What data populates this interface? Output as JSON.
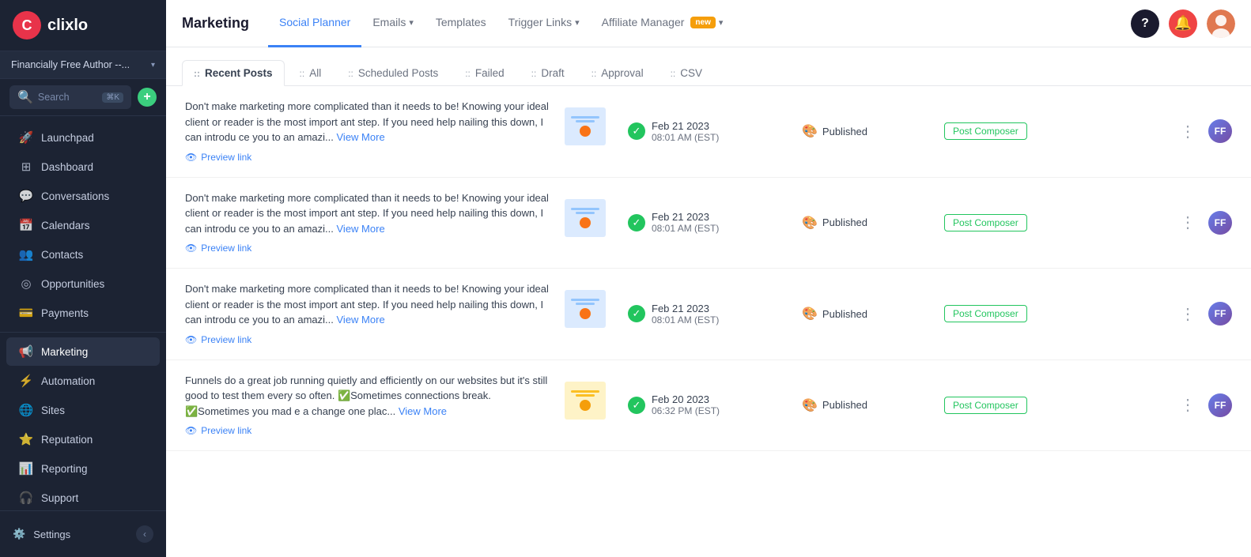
{
  "app": {
    "logo_letter": "C",
    "logo_name": "clixlo"
  },
  "account": {
    "name": "Financially Free Author --...",
    "dropdown_label": "Financially Free Author --..."
  },
  "search": {
    "placeholder": "Search",
    "shortcut": "⌘K"
  },
  "sidebar": {
    "items": [
      {
        "id": "launchpad",
        "label": "Launchpad",
        "icon": "🚀"
      },
      {
        "id": "dashboard",
        "label": "Dashboard",
        "icon": "⊞"
      },
      {
        "id": "conversations",
        "label": "Conversations",
        "icon": "💬"
      },
      {
        "id": "calendars",
        "label": "Calendars",
        "icon": "📅"
      },
      {
        "id": "contacts",
        "label": "Contacts",
        "icon": "👥"
      },
      {
        "id": "opportunities",
        "label": "Opportunities",
        "icon": "◎"
      },
      {
        "id": "payments",
        "label": "Payments",
        "icon": "💳"
      },
      {
        "id": "marketing",
        "label": "Marketing",
        "icon": "📢",
        "active": true
      },
      {
        "id": "automation",
        "label": "Automation",
        "icon": "⚡"
      },
      {
        "id": "sites",
        "label": "Sites",
        "icon": "🌐"
      },
      {
        "id": "reputation",
        "label": "Reputation",
        "icon": "⭐"
      },
      {
        "id": "reporting",
        "label": "Reporting",
        "icon": "📊"
      },
      {
        "id": "support",
        "label": "Support",
        "icon": "🎧"
      }
    ],
    "footer": {
      "settings_label": "Settings",
      "settings_icon": "⚙️"
    }
  },
  "topbar": {
    "title": "Marketing",
    "nav_items": [
      {
        "id": "social-planner",
        "label": "Social Planner",
        "active": true,
        "has_dropdown": false
      },
      {
        "id": "emails",
        "label": "Emails",
        "active": false,
        "has_dropdown": true
      },
      {
        "id": "templates",
        "label": "Templates",
        "active": false,
        "has_dropdown": false
      },
      {
        "id": "trigger-links",
        "label": "Trigger Links",
        "active": false,
        "has_dropdown": true
      },
      {
        "id": "affiliate-manager",
        "label": "Affiliate Manager",
        "active": false,
        "has_dropdown": true,
        "badge": "new"
      }
    ]
  },
  "tabs": [
    {
      "id": "recent-posts",
      "label": "Recent Posts",
      "active": true
    },
    {
      "id": "all",
      "label": "All",
      "active": false
    },
    {
      "id": "scheduled-posts",
      "label": "Scheduled Posts",
      "active": false
    },
    {
      "id": "failed",
      "label": "Failed",
      "active": false
    },
    {
      "id": "draft",
      "label": "Draft",
      "active": false
    },
    {
      "id": "approval",
      "label": "Approval",
      "active": false
    },
    {
      "id": "csv",
      "label": "CSV",
      "active": false
    }
  ],
  "posts": [
    {
      "id": "post-1",
      "text": "Don't make marketing more complicated than it needs to be! Knowing your ideal client or reader is the most import ant step. If you need help nailing this down, I can introdu ce you to an amazi...",
      "view_more": "View More",
      "preview_label": "Preview link",
      "date": "Feb 21 2023",
      "time": "08:01 AM (EST)",
      "status": "Published",
      "source": "Post Composer"
    },
    {
      "id": "post-2",
      "text": "Don't make marketing more complicated than it needs to be! Knowing your ideal client or reader is the most import ant step. If you need help nailing this down, I can introdu ce you to an amazi...",
      "view_more": "View More",
      "preview_label": "Preview link",
      "date": "Feb 21 2023",
      "time": "08:01 AM (EST)",
      "status": "Published",
      "source": "Post Composer"
    },
    {
      "id": "post-3",
      "text": "Don't make marketing more complicated than it needs to be! Knowing your ideal client or reader is the most import ant step. If you need help nailing this down, I can introdu ce you to an amazi...",
      "view_more": "View More",
      "preview_label": "Preview link",
      "date": "Feb 21 2023",
      "time": "08:01 AM (EST)",
      "status": "Published",
      "source": "Post Composer"
    },
    {
      "id": "post-4",
      "text": "Funnels do a great job running quietly and efficiently on our websites but it's still good to test them every so often. ✅Sometimes connections break. ✅Sometimes you mad e a change one plac...",
      "view_more": "View More",
      "preview_label": "Preview link",
      "date": "Feb 20 2023",
      "time": "06:32 PM (EST)",
      "status": "Published",
      "source": "Post Composer"
    }
  ],
  "labels": {
    "add_btn": "+",
    "view_more": "View More",
    "preview_link": "Preview link",
    "published": "Published",
    "post_composer": "Post Composer",
    "more_options": "⋮"
  }
}
